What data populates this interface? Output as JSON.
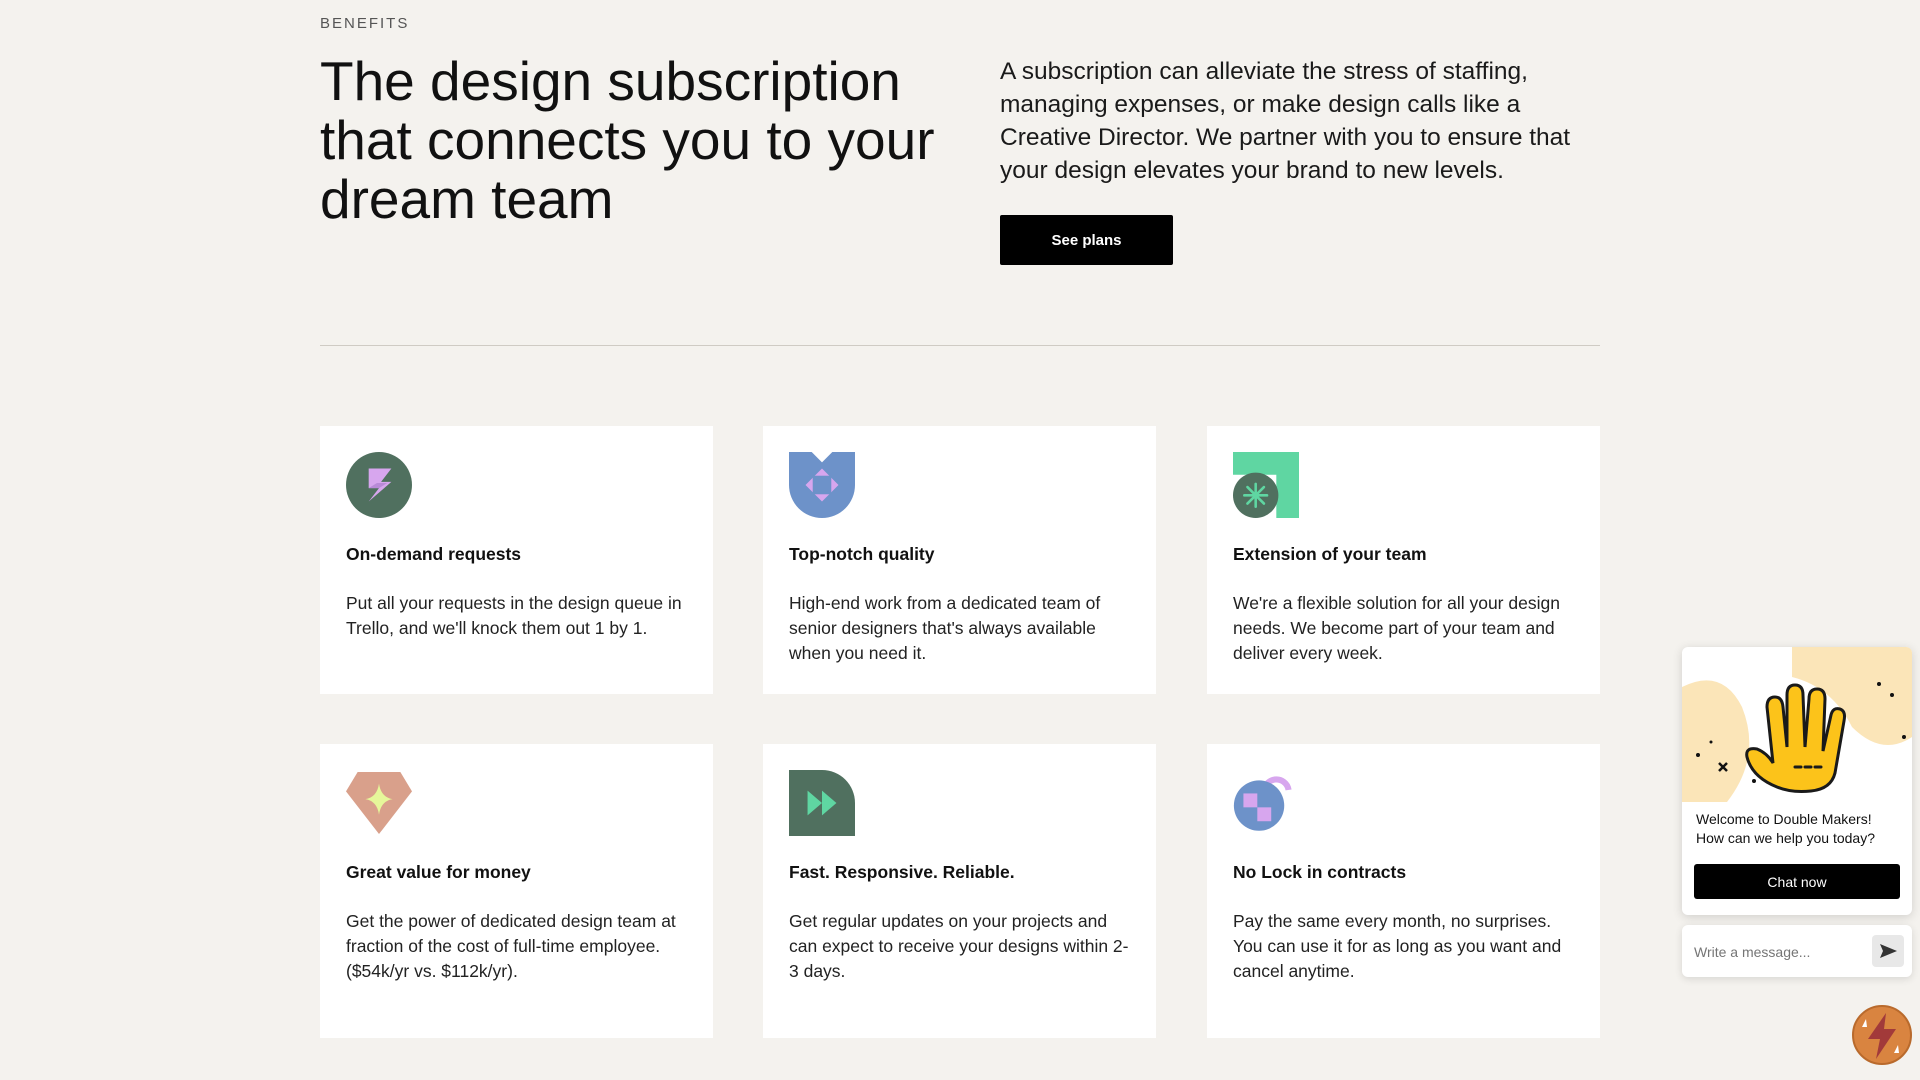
{
  "section": {
    "eyebrow": "BENEFITS",
    "headline": "The design subscription that connects you to your dream team",
    "lead": "A subscription can alleviate the stress of staffing, managing expenses, or make design calls like a Creative Director. We partner with you to ensure that your design elevates your brand to new levels.",
    "cta_label": "See plans"
  },
  "benefits": [
    {
      "icon": "lightning-bolt-icon",
      "title": "On-demand requests",
      "desc": "Put all your requests in the design queue in Trello, and we'll knock them out 1 by 1."
    },
    {
      "icon": "quality-badge-icon",
      "title": "Top-notch quality",
      "desc": "High-end work from a dedicated team of senior designers that's always available when you need it."
    },
    {
      "icon": "asterisk-corner-icon",
      "title": "Extension of your team",
      "desc": "We're a flexible solution for all your design needs. We become part of your team and deliver every week."
    },
    {
      "icon": "gem-sparkle-icon",
      "title": "Great value for money",
      "desc": "Get the power of dedicated design team at fraction of the cost of full-time employee. ($54k/yr vs. $112k/yr)."
    },
    {
      "icon": "fast-forward-icon",
      "title": "Fast. Responsive. Reliable.",
      "desc": "Get regular updates on your projects and can expect to receive your designs within 2-3 days."
    },
    {
      "icon": "unlocked-padlock-icon",
      "title": "No Lock in contracts",
      "desc": "Pay the same every month, no surprises. You can use it for as long as you want and cancel anytime."
    }
  ],
  "chat": {
    "welcome_line1": "Welcome to Double Makers!",
    "welcome_line2": "How can we help you today?",
    "button_label": "Chat now",
    "input_placeholder": "Write a message..."
  },
  "colors": {
    "background": "#f4f2ee",
    "dark_green": "#50705f",
    "lavender": "#d7a6ee",
    "blue": "#6d92c9",
    "mint": "#5fd6a2",
    "terracotta": "#d9a08b",
    "lime": "#e6f79a"
  }
}
